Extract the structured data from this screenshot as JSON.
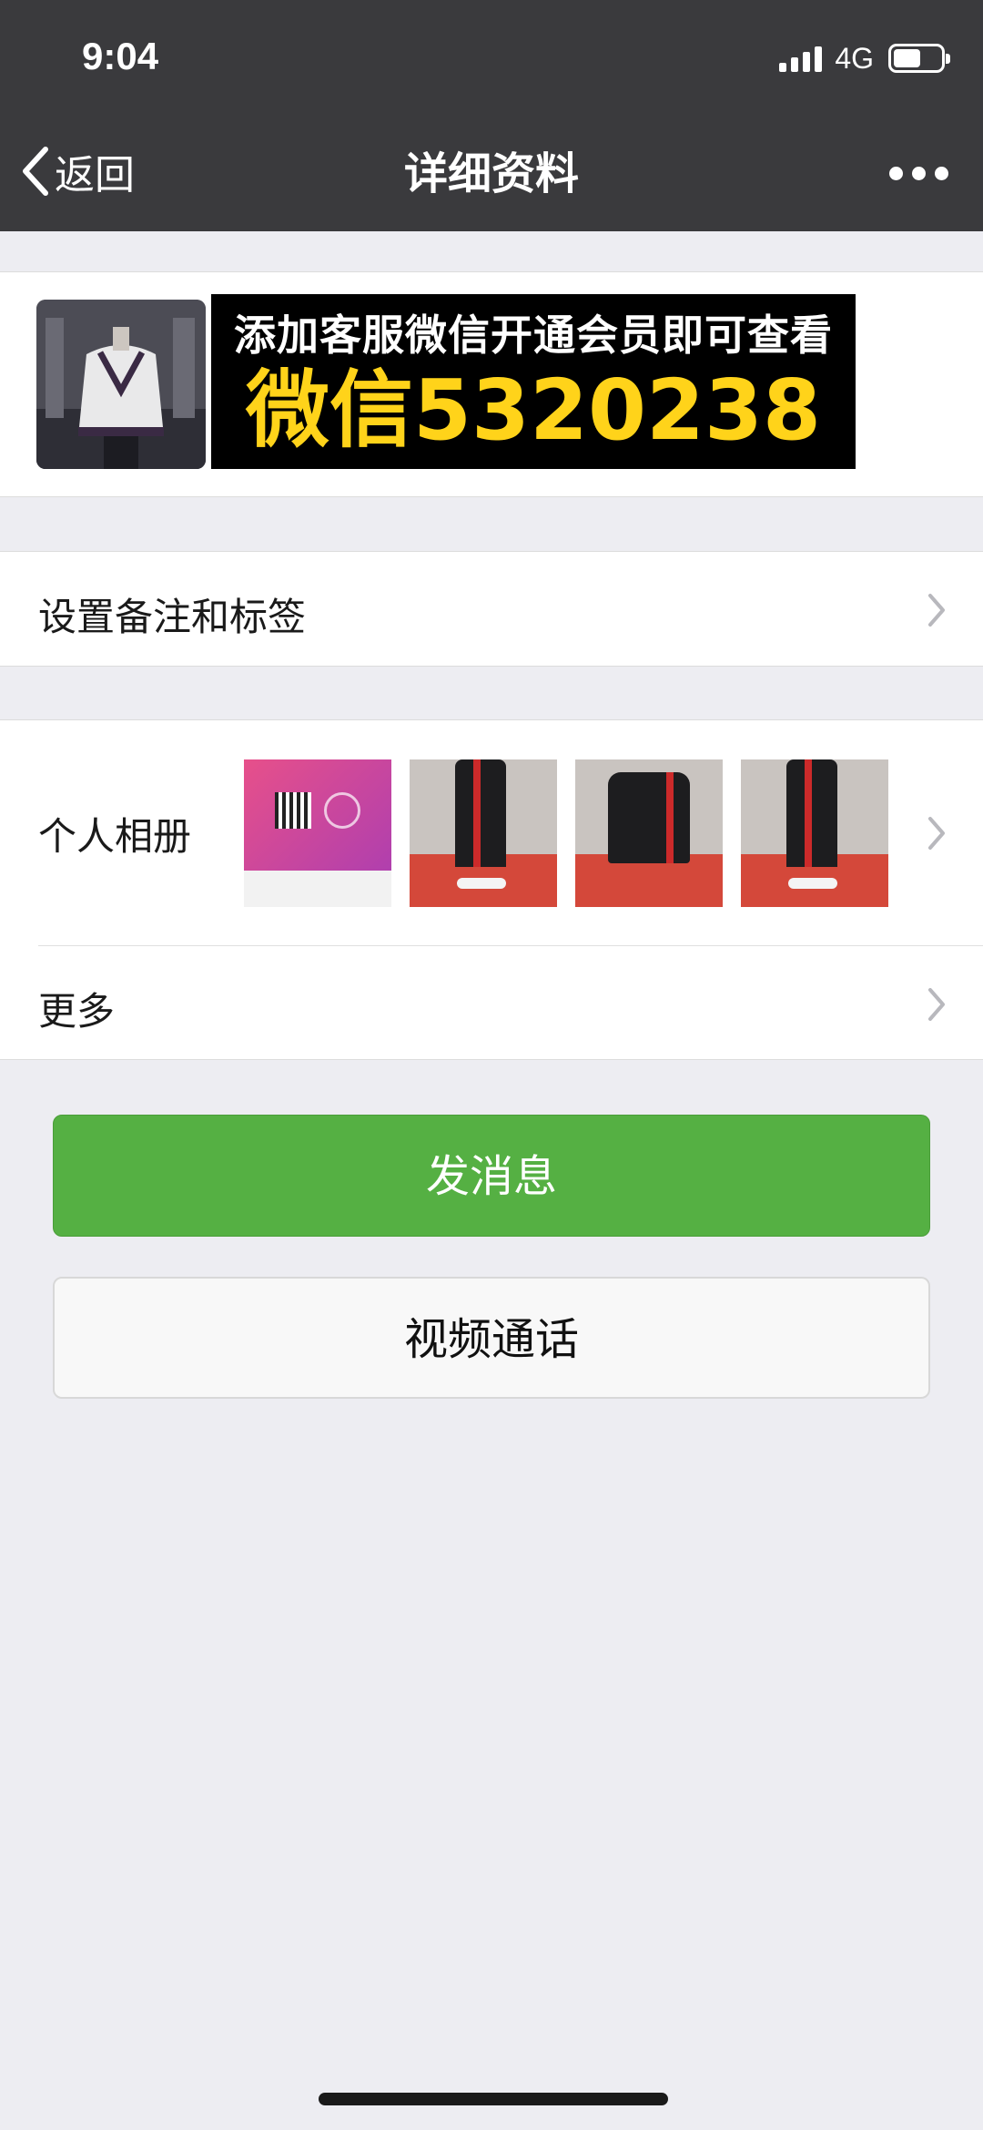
{
  "status_bar": {
    "time": "9:04",
    "network": "4G"
  },
  "nav": {
    "back_label": "返回",
    "title": "详细资料"
  },
  "profile": {
    "banner_line1": "添加客服微信开通会员即可查看",
    "banner_line2": "微信5320238"
  },
  "cells": {
    "remark_label": "设置备注和标签",
    "album_label": "个人相册",
    "more_label": "更多"
  },
  "buttons": {
    "send_message": "发消息",
    "video_call": "视频通话"
  },
  "colors": {
    "header_bg": "#3a3a3d",
    "page_bg": "#ededf2",
    "primary_green": "#55b043",
    "banner_yellow": "#ffd31a"
  }
}
